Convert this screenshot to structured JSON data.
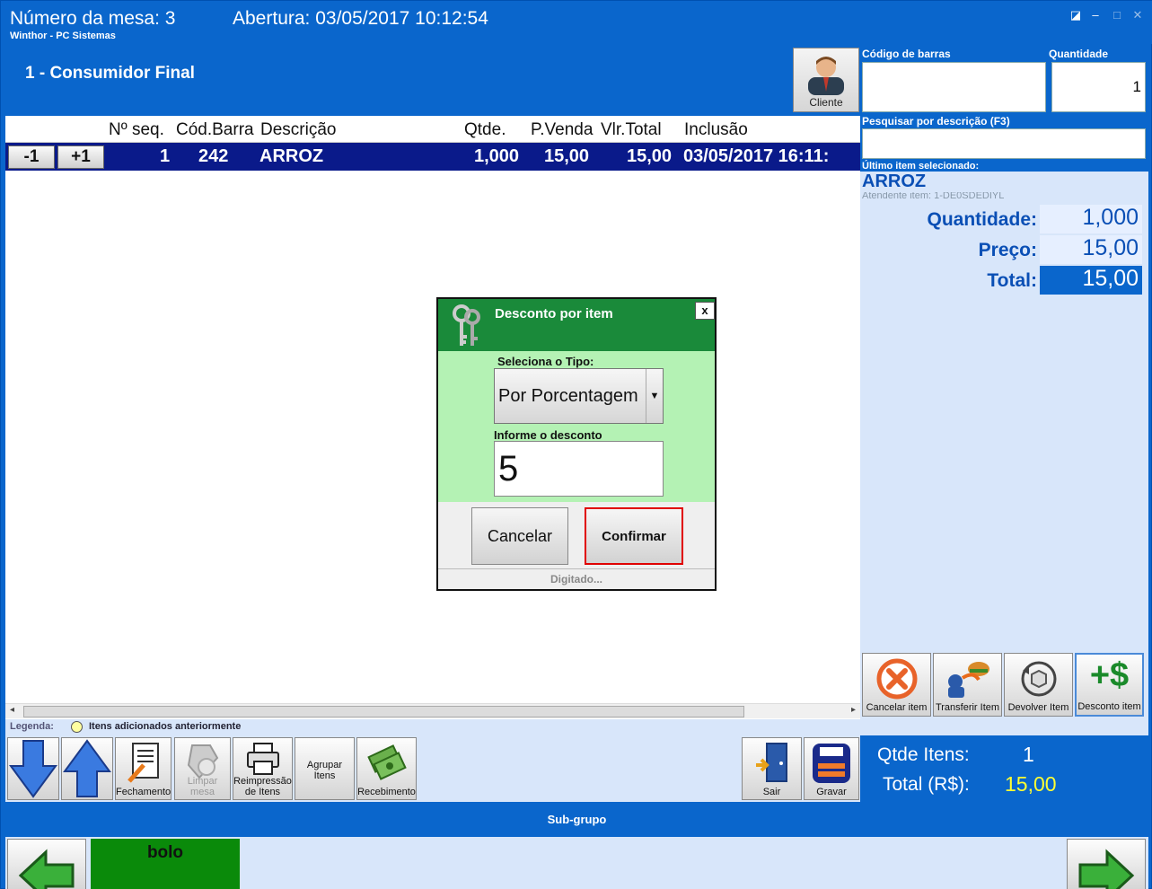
{
  "titlebar": {
    "mesa": "Número da mesa: 3",
    "abertura": "Abertura: 03/05/2017 10:12:54",
    "subtitle": "Winthor - PC Sistemas"
  },
  "client": {
    "name": "1 - Consumidor Final",
    "button_label": "Cliente"
  },
  "grid": {
    "columns": [
      "Nº seq.",
      "Cód.Barra",
      "Descrição",
      "Qtde.",
      "P.Venda",
      "Vlr.Total",
      "Inclusão"
    ],
    "rows": [
      {
        "minus": "-1",
        "plus": "+1",
        "seq": "1",
        "barcode": "242",
        "desc": "ARROZ",
        "qty": "1,000",
        "price": "15,00",
        "total": "15,00",
        "inclusao": "03/05/2017 16:11:"
      }
    ]
  },
  "right_panel": {
    "barcode_label": "Código de barras",
    "qty_label": "Quantidade",
    "qty_value": "1",
    "search_label": "Pesquisar por descrição (F3)",
    "last_item_label": "Último item selecionado:",
    "last_item_name": "ARROZ",
    "last_item_sub": "Atendente item: 1-DE0SDEDIYL",
    "quantidade_label": "Quantidade:",
    "quantidade_value": "1,000",
    "preco_label": "Preço:",
    "preco_value": "15,00",
    "total_label": "Total:",
    "total_value": "15,00",
    "actions": [
      "Cancelar item",
      "Transferir Item",
      "Devolver Item",
      "Desconto item"
    ],
    "summary": {
      "qtde_label": "Qtde Itens:",
      "qtde_value": "1",
      "total_label": "Total (R$):",
      "total_value": "15,00"
    }
  },
  "legend": {
    "label": "Legenda:",
    "item": "Itens adicionados anteriormente"
  },
  "toolbar": {
    "fechamento": "Fechamento",
    "limpar": "Limpar mesa",
    "reimpressao_1": "Reimpressão",
    "reimpressao_2": "de Itens",
    "agrupar_1": "Agrupar",
    "agrupar_2": "Itens",
    "recebimento": "Recebimento",
    "sair": "Sair",
    "gravar": "Gravar"
  },
  "subgroup": {
    "label": "Sub-grupo",
    "item": "bolo"
  },
  "dialog": {
    "title": "Desconto por item",
    "close": "x",
    "tipo_label": "Seleciona o Tipo:",
    "tipo_value": "Por Porcentagem",
    "desconto_label": "Informe o desconto",
    "desconto_value": "5",
    "cancel": "Cancelar",
    "confirm": "Confirmar",
    "footer": "Digitado..."
  },
  "colors": {
    "primary_blue": "#0a66cc",
    "selected_row": "#0a1a8a",
    "dialog_header": "#1a8a3a",
    "dialog_body": "#b4f2b4",
    "confirm_border": "#e00000",
    "summary_value": "#ffff33"
  }
}
